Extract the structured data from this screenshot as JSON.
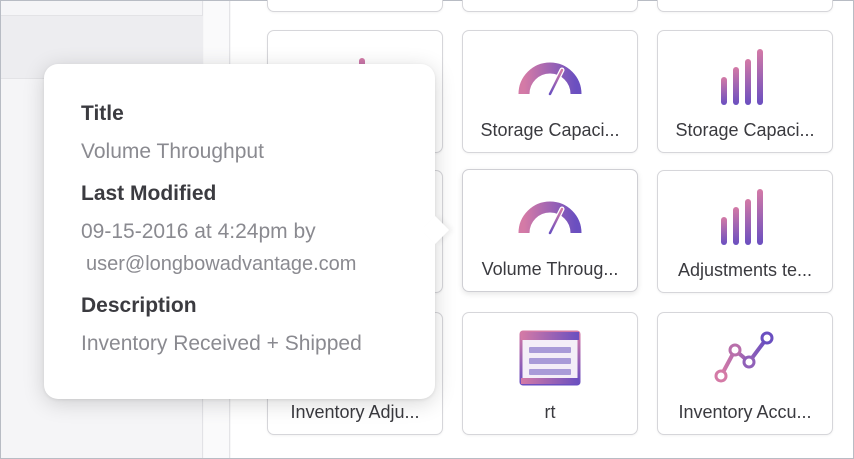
{
  "tiles": [
    {
      "label": "",
      "icon": "bar-chart-icon"
    },
    {
      "label": "",
      "icon": "unknown"
    },
    {
      "label": "",
      "icon": "unknown"
    },
    {
      "label": "",
      "icon": "bar-chart-icon"
    },
    {
      "label": "Storage Capaci...",
      "icon": "gauge-icon"
    },
    {
      "label": "Storage Capaci...",
      "icon": "bar-chart-icon"
    },
    {
      "label": "",
      "icon": "unknown"
    },
    {
      "label": "Volume Throug...",
      "icon": "gauge-icon"
    },
    {
      "label": "Adjustments te...",
      "icon": "bar-chart-icon"
    },
    {
      "label": "Inventory Adju...",
      "icon": "unknown"
    },
    {
      "label": "rt",
      "icon": "table-icon"
    },
    {
      "label": "Inventory Accu...",
      "icon": "line-chart-icon"
    }
  ],
  "popover": {
    "title_heading": "Title",
    "title_value": "Volume Throughput",
    "modified_heading": "Last Modified",
    "modified_line1": "09-15-2016 at 4:24pm by",
    "modified_line2": "user@longbowadvantage.com",
    "description_heading": "Description",
    "description_value": "Inventory Received + Shipped"
  },
  "colors": {
    "icon_gradient_top": "#d47aa6",
    "icon_gradient_bottom": "#6a4fc0",
    "border": "#d6d6da"
  }
}
